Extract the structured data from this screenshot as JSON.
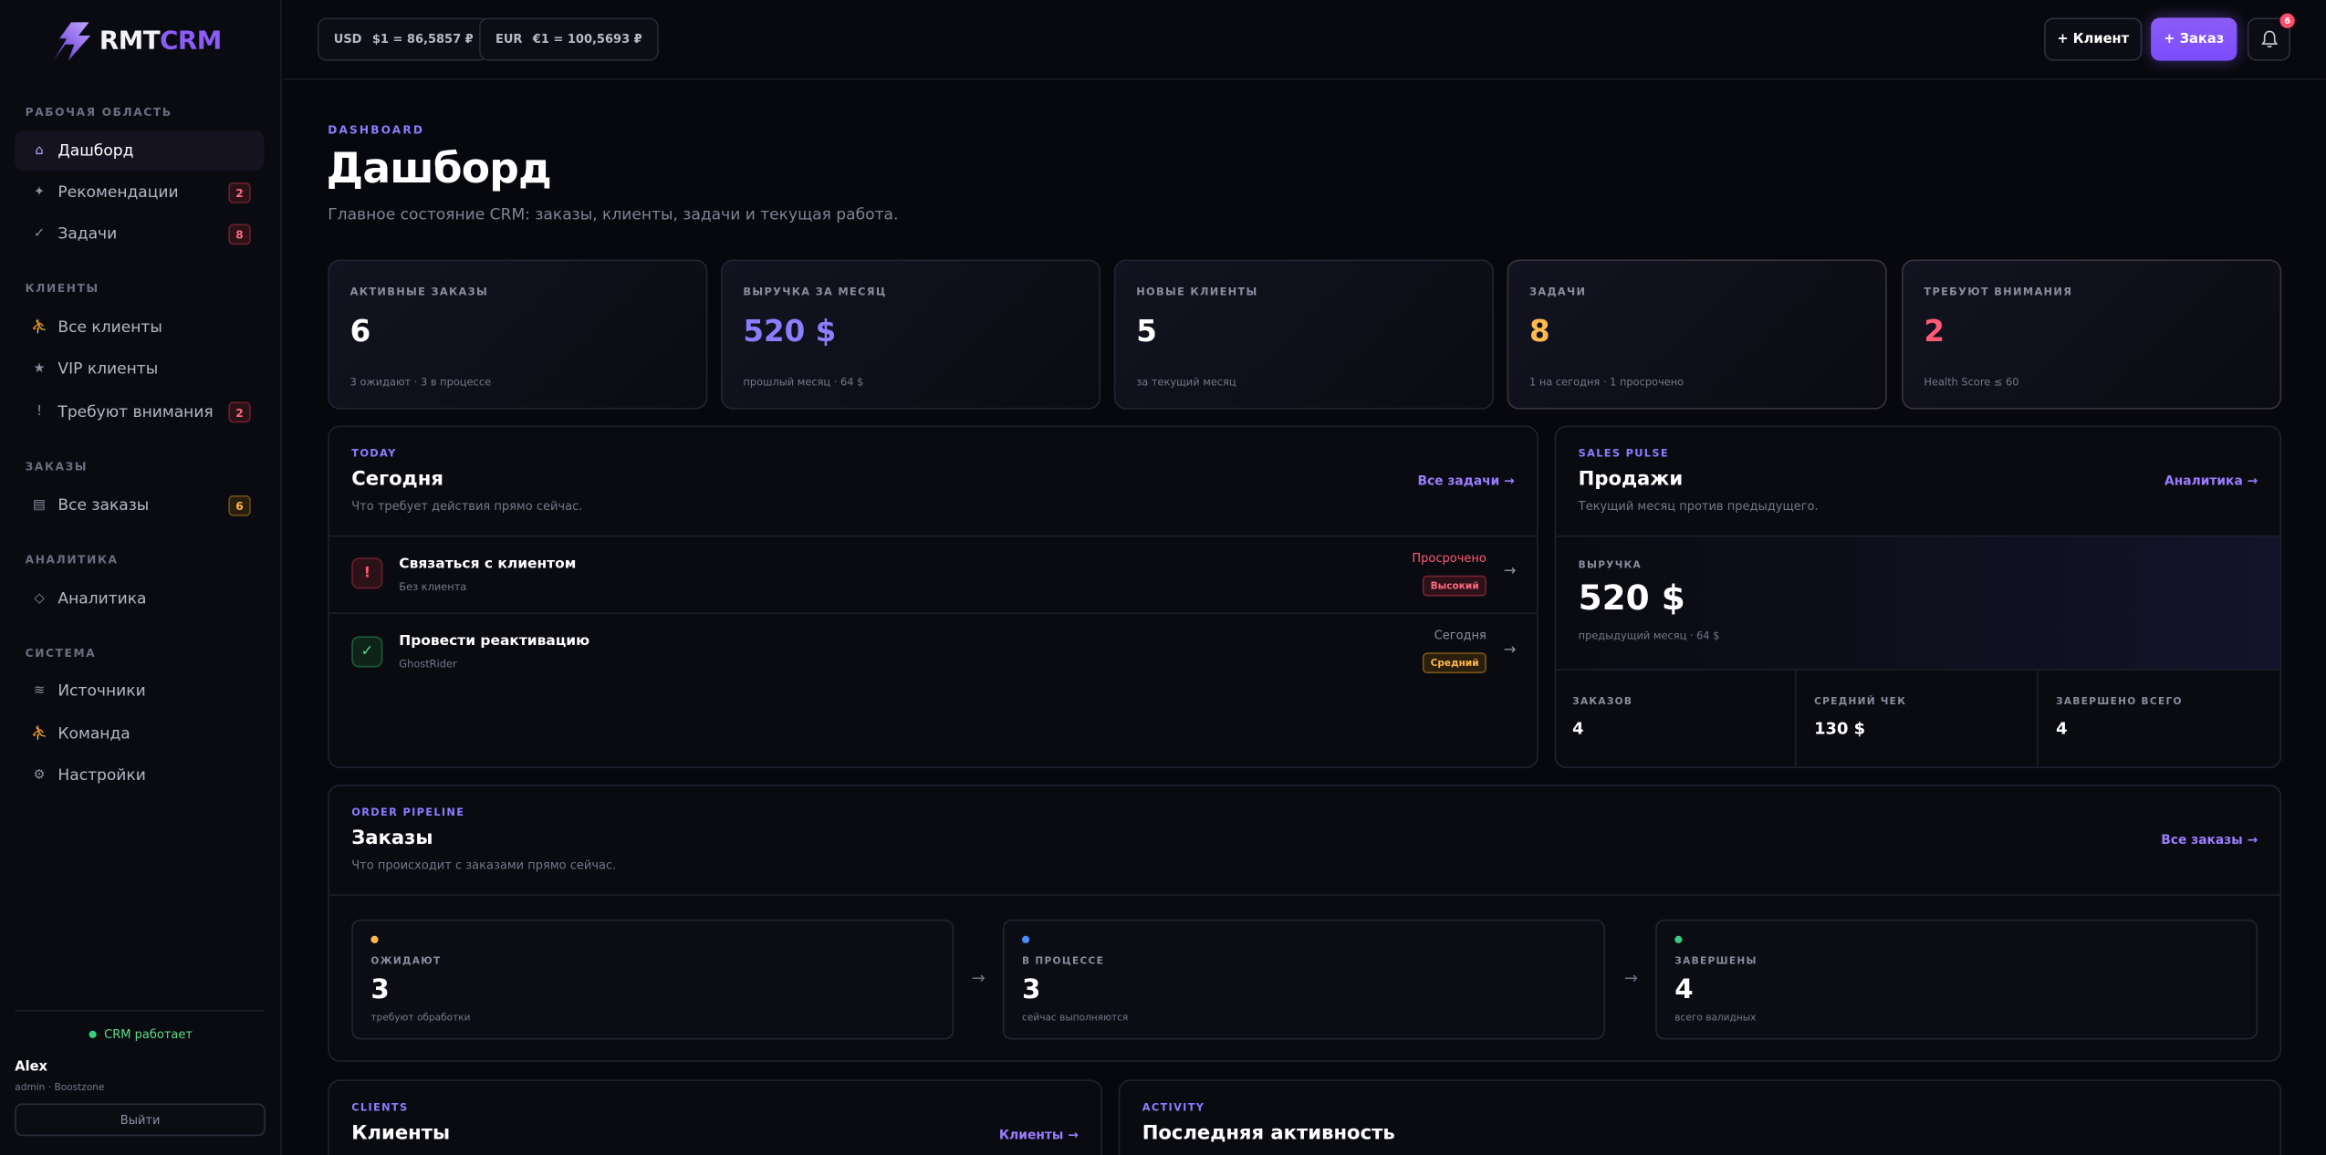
{
  "brand": {
    "logo_part1": "RMT",
    "logo_part2": "CRM"
  },
  "sidebar": {
    "sections": {
      "workspace": "РАБОЧАЯ ОБЛАСТЬ",
      "clients": "КЛИЕНТЫ",
      "orders": "ЗАКАЗЫ",
      "analytics": "АНАЛИТИКА",
      "system": "СИСТЕМА"
    },
    "items": [
      {
        "label": "Дашборд",
        "icon": "home-icon",
        "glyph": "⌂",
        "active": true
      },
      {
        "label": "Рекомендации",
        "icon": "sparkle-icon",
        "glyph": "✦",
        "badge": "2"
      },
      {
        "label": "Задачи",
        "icon": "check-icon",
        "glyph": "✓",
        "badge": "8"
      },
      {
        "label": "Все клиенты",
        "icon": "user-icon",
        "glyph": "⛹"
      },
      {
        "label": "VIP клиенты",
        "icon": "star-icon",
        "glyph": "★"
      },
      {
        "label": "Требуют внимания",
        "icon": "alert-icon",
        "glyph": "!",
        "badge": "2"
      },
      {
        "label": "Все заказы",
        "icon": "list-icon",
        "glyph": "▤",
        "badge": "6"
      },
      {
        "label": "Аналитика",
        "icon": "diamond-icon",
        "glyph": "◇"
      },
      {
        "label": "Источники",
        "icon": "wave-icon",
        "glyph": "≋"
      },
      {
        "label": "Команда",
        "icon": "team-icon",
        "glyph": "⛹"
      },
      {
        "label": "Настройки",
        "icon": "gear-icon",
        "glyph": "⚙"
      }
    ],
    "status": "CRM работает",
    "user": {
      "name": "Alex",
      "role": "admin · Boostzone"
    },
    "logout": "Выйти"
  },
  "topbar": {
    "rates": [
      {
        "currency": "USD",
        "value": "$1 = 86,5857 ₽"
      },
      {
        "currency": "EUR",
        "value": "€1 = 100,5693 ₽"
      }
    ],
    "add_client": "+ Клиент",
    "add_order": "+ Заказ",
    "notifications_count": "6"
  },
  "header": {
    "eyebrow": "DASHBOARD",
    "title": "Дашборд",
    "subtitle": "Главное состояние CRM: заказы, клиенты, задачи и текущая работа."
  },
  "stats": [
    {
      "label": "АКТИВНЫЕ ЗАКАЗЫ",
      "value": "6",
      "sub": "3 ожидают · 3 в процессе",
      "color": "#ffffff"
    },
    {
      "label": "ВЫРУЧКА ЗА МЕСЯЦ",
      "value": "520 $",
      "sub": "прошлый месяц · 64 $",
      "color": "#8b7dff"
    },
    {
      "label": "НОВЫЕ КЛИЕНТЫ",
      "value": "5",
      "sub": "за текущий месяц",
      "color": "#ffffff"
    },
    {
      "label": "ЗАДАЧИ",
      "value": "8",
      "sub": "1 на сегодня · 1 просрочено",
      "color": "#ffb84d"
    },
    {
      "label": "ТРЕБУЮТ ВНИМАНИЯ",
      "value": "2",
      "sub": "Health Score ≤ 60",
      "color": "#ff5a74"
    }
  ],
  "today": {
    "eyebrow": "TODAY",
    "title": "Сегодня",
    "subtitle": "Что требует действия прямо сейчас.",
    "link": "Все задачи →",
    "tasks": [
      {
        "title": "Связаться с клиентом",
        "sub": "Без клиента",
        "due": "Просрочено",
        "priority": "Высокий",
        "icon": "!"
      },
      {
        "title": "Провести реактивацию",
        "sub": "GhostRider",
        "due": "Сегодня",
        "priority": "Средний",
        "icon": "✓"
      }
    ]
  },
  "sales": {
    "eyebrow": "SALES PULSE",
    "title": "Продажи",
    "subtitle": "Текущий месяц против предыдущего.",
    "link": "Аналитика →",
    "revenue_label": "ВЫРУЧКА",
    "revenue_value": "520 $",
    "revenue_sub": "предыдущий месяц · 64 $",
    "metrics": [
      {
        "label": "ЗАКАЗОВ",
        "value": "4"
      },
      {
        "label": "СРЕДНИЙ ЧЕК",
        "value": "130 $"
      },
      {
        "label": "ЗАВЕРШЕНО ВСЕГО",
        "value": "4"
      }
    ]
  },
  "pipeline": {
    "eyebrow": "ORDER PIPELINE",
    "title": "Заказы",
    "subtitle": "Что происходит с заказами прямо сейчас.",
    "link": "Все заказы →",
    "stages": [
      {
        "label": "ОЖИДАЮТ",
        "value": "3",
        "sub": "требуют обработки",
        "color": "#ffb84d"
      },
      {
        "label": "В ПРОЦЕССЕ",
        "value": "3",
        "sub": "сейчас выполняются",
        "color": "#4d8dff"
      },
      {
        "label": "ЗАВЕРШЕНЫ",
        "value": "4",
        "sub": "всего валидных",
        "color": "#35d07f"
      }
    ],
    "arrow": "→"
  },
  "clients_panel": {
    "eyebrow": "CLIENTS",
    "title": "Клиенты",
    "link": "Клиенты →"
  },
  "activity_panel": {
    "eyebrow": "ACTIVITY",
    "title": "Последняя активность"
  }
}
